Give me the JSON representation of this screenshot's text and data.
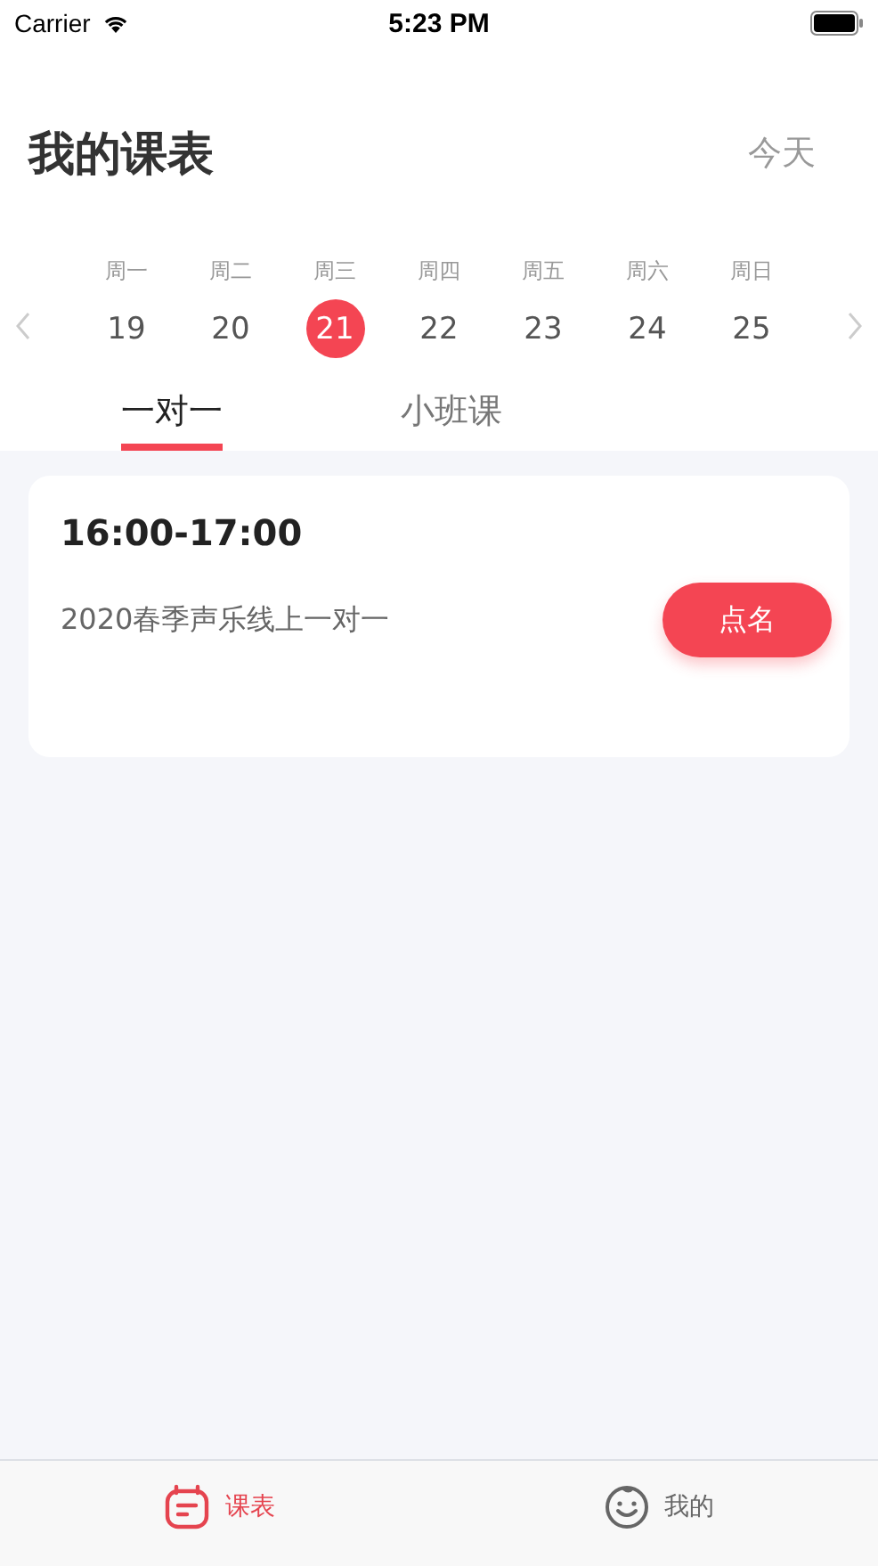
{
  "status_bar": {
    "carrier": "Carrier",
    "time": "5:23 PM"
  },
  "header": {
    "title": "我的课表",
    "today": "今天"
  },
  "week": [
    {
      "weekday": "周一",
      "date": "19",
      "selected": false
    },
    {
      "weekday": "周二",
      "date": "20",
      "selected": false
    },
    {
      "weekday": "周三",
      "date": "21",
      "selected": true
    },
    {
      "weekday": "周四",
      "date": "22",
      "selected": false
    },
    {
      "weekday": "周五",
      "date": "23",
      "selected": false
    },
    {
      "weekday": "周六",
      "date": "24",
      "selected": false
    },
    {
      "weekday": "周日",
      "date": "25",
      "selected": false
    }
  ],
  "tabs": [
    {
      "label": "一对一",
      "selected": true
    },
    {
      "label": "小班课",
      "selected": false
    }
  ],
  "lessons": [
    {
      "time": "16:00-17:00",
      "name": "2020春季声乐线上一对一",
      "action": "点名"
    }
  ],
  "tab_bar": [
    {
      "kind": "schedule",
      "label": "课表",
      "selected": true
    },
    {
      "kind": "profile",
      "label": "我的",
      "selected": false
    }
  ]
}
